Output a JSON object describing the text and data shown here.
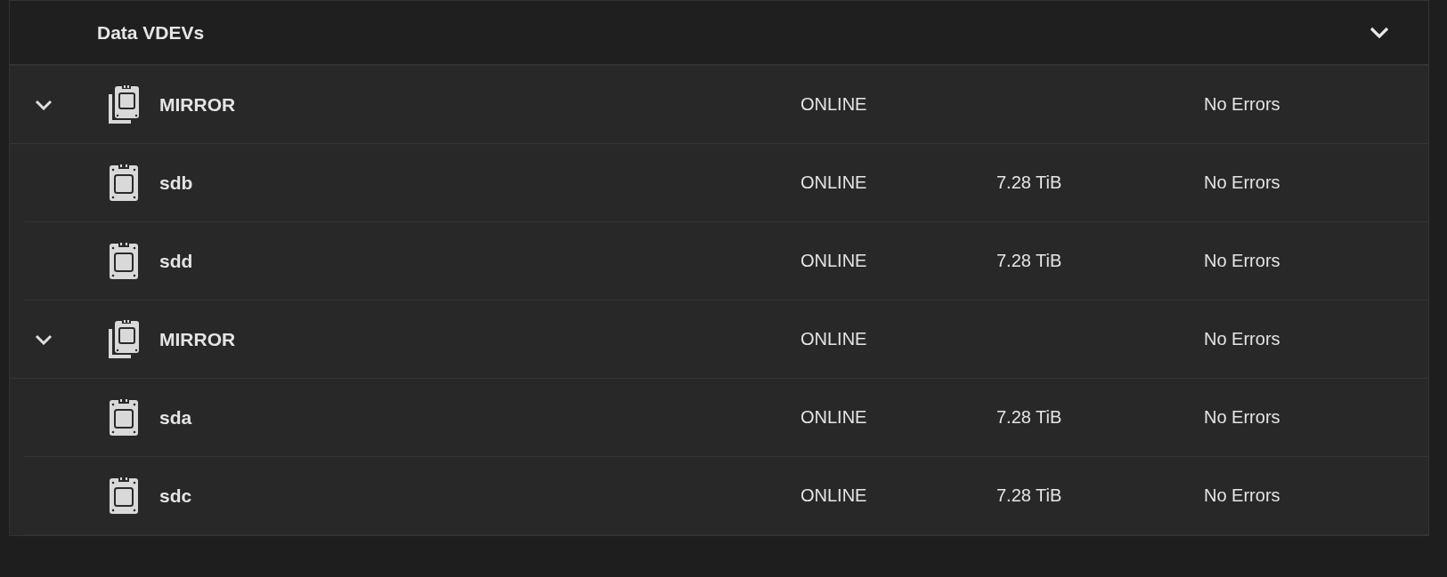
{
  "panel": {
    "title": "Data VDEVs",
    "expanded": true
  },
  "vdevs": [
    {
      "name": "MIRROR",
      "status": "ONLINE",
      "errors": "No Errors",
      "expanded": true,
      "children": [
        {
          "name": "sdb",
          "status": "ONLINE",
          "capacity": "7.28 TiB",
          "errors": "No Errors"
        },
        {
          "name": "sdd",
          "status": "ONLINE",
          "capacity": "7.28 TiB",
          "errors": "No Errors"
        }
      ]
    },
    {
      "name": "MIRROR",
      "status": "ONLINE",
      "errors": "No Errors",
      "expanded": true,
      "children": [
        {
          "name": "sda",
          "status": "ONLINE",
          "capacity": "7.28 TiB",
          "errors": "No Errors"
        },
        {
          "name": "sdc",
          "status": "ONLINE",
          "capacity": "7.28 TiB",
          "errors": "No Errors"
        }
      ]
    }
  ]
}
